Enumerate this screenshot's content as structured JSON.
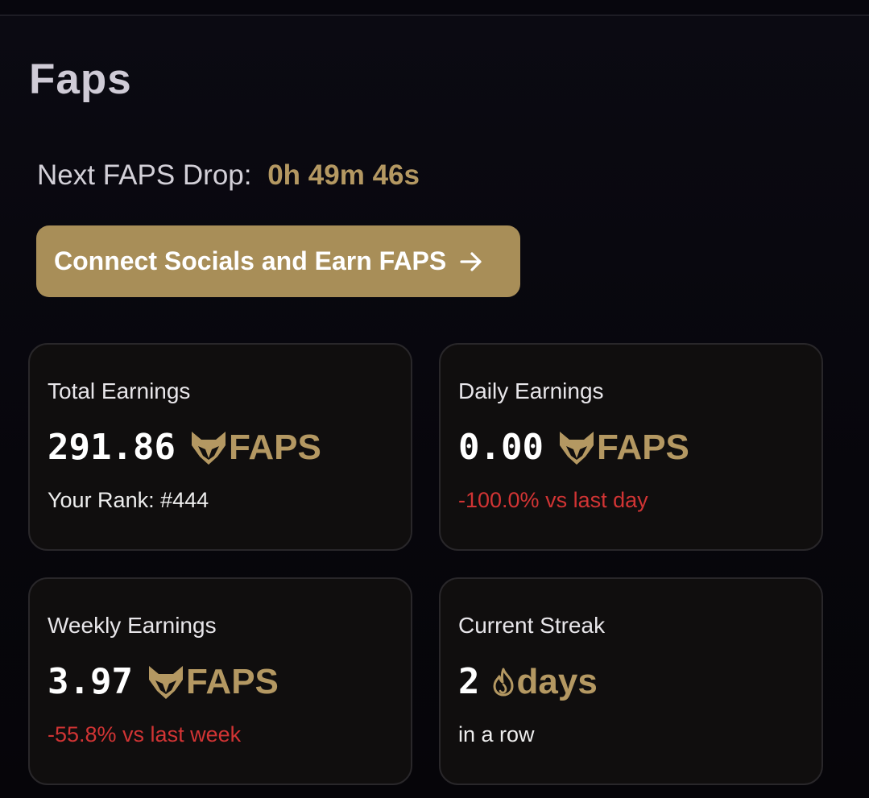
{
  "page": {
    "title": "Faps"
  },
  "drop": {
    "label": "Next FAPS Drop:",
    "timer": "0h 49m 46s"
  },
  "cta": {
    "label": "Connect Socials and Earn FAPS"
  },
  "cards": {
    "total": {
      "label": "Total Earnings",
      "value": "291.86",
      "unit": "FAPS",
      "sub": "Your Rank: #444"
    },
    "daily": {
      "label": "Daily Earnings",
      "value": "0.00",
      "unit": "FAPS",
      "sub": "-100.0% vs last day"
    },
    "weekly": {
      "label": "Weekly Earnings",
      "value": "3.97",
      "unit": "FAPS",
      "sub": "-55.8% vs last week"
    },
    "streak": {
      "label": "Current Streak",
      "value": "2",
      "unit": "days",
      "sub": "in a row"
    }
  },
  "colors": {
    "accent": "#a88e58",
    "accent_text": "#b49862",
    "negative": "#d13434",
    "background": "#06050c",
    "card": "#100e0e"
  },
  "icons": {
    "token": "fox-head-icon",
    "streak": "flame-icon",
    "cta": "arrow-right-icon"
  }
}
